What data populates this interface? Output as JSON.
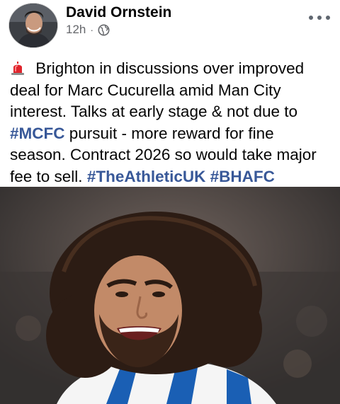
{
  "post": {
    "author_name": "David Ornstein",
    "timestamp": "12h",
    "separator": "·",
    "privacy_icon": "globe-icon",
    "more_icon": "more-horizontal-icon",
    "alert_icon": "police-siren-icon",
    "text_segments": [
      " Brighton in discussions over improved deal for Marc Cucurella amid Man City interest. Talks at early stage & not due to ",
      "#MCFC",
      " pursuit - more reward for fine season. Contract 2026 so would take major fee to sell. ",
      "#TheAthleticUK",
      " ",
      "#BHAFC"
    ]
  },
  "colors": {
    "hashtag": "#385898",
    "meta_text": "#65676b",
    "body_text": "#050505"
  }
}
